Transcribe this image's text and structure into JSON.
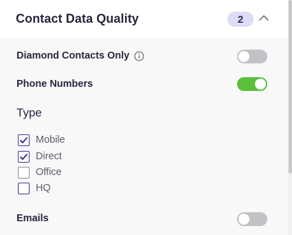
{
  "header": {
    "title": "Contact Data Quality",
    "badge_count": "2",
    "expanded": true
  },
  "rows": {
    "diamond": {
      "label": "Diamond Contacts Only",
      "enabled": false
    },
    "phone": {
      "label": "Phone Numbers",
      "enabled": true
    },
    "emails": {
      "label": "Emails",
      "enabled": false
    }
  },
  "type_section": {
    "title": "Type",
    "options": [
      {
        "label": "Mobile",
        "checked": true
      },
      {
        "label": "Direct",
        "checked": true
      },
      {
        "label": "Office",
        "checked": false
      },
      {
        "label": "HQ",
        "checked": false
      }
    ]
  },
  "colors": {
    "accent": "#3b2f9a",
    "toggle_on": "#5bbf3a",
    "toggle_off": "#c2c2c6",
    "badge_bg": "#dcdcf7"
  },
  "icons": {
    "collapse": "chevron-up-icon",
    "info": "info-icon",
    "check": "check-icon"
  }
}
